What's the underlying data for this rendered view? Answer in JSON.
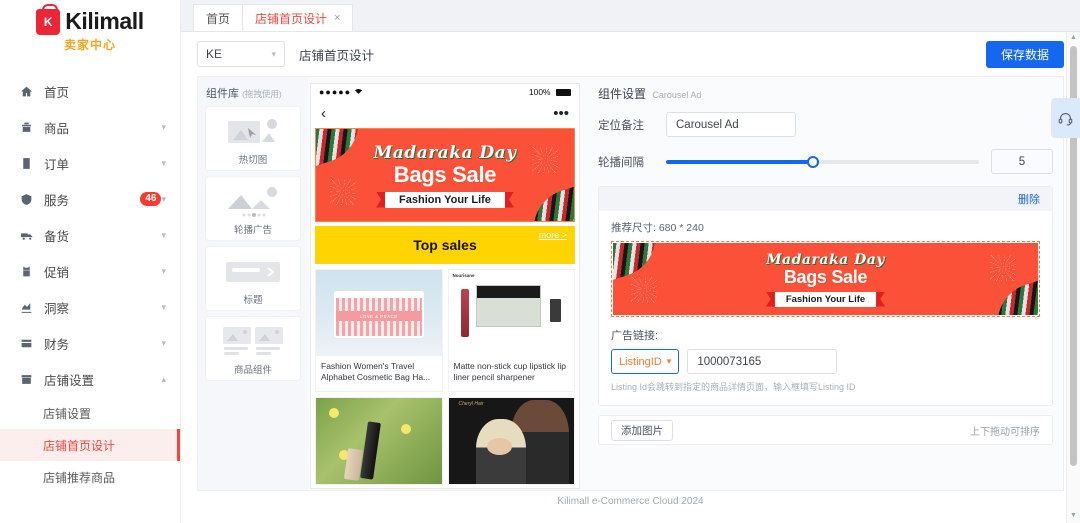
{
  "brand": {
    "name": "Kilimall",
    "sub": "卖家中心",
    "logo_letter": "K",
    "color": "#ee2536"
  },
  "sidebar": {
    "items": [
      {
        "icon": "home-icon",
        "label": "首页",
        "has_chevron": false
      },
      {
        "icon": "product-icon",
        "label": "商品",
        "has_chevron": true
      },
      {
        "icon": "order-icon",
        "label": "订单",
        "has_chevron": true
      },
      {
        "icon": "service-icon",
        "label": "服务",
        "badge": "46",
        "has_chevron": true
      },
      {
        "icon": "stock-icon",
        "label": "备货",
        "has_chevron": true
      },
      {
        "icon": "promotion-icon",
        "label": "促销",
        "has_chevron": true
      },
      {
        "icon": "insight-icon",
        "label": "洞察",
        "has_chevron": true
      },
      {
        "icon": "finance-icon",
        "label": "财务",
        "has_chevron": true
      },
      {
        "icon": "shop-settings-icon",
        "label": "店铺设置",
        "has_chevron": true,
        "expanded": true
      }
    ],
    "sub_items": [
      {
        "label": "店铺设置",
        "active": false
      },
      {
        "label": "店铺首页设计",
        "active": true
      },
      {
        "label": "店铺推荐商品",
        "active": false
      }
    ]
  },
  "tabs": [
    {
      "label": "首页",
      "active": false,
      "closable": false
    },
    {
      "label": "店铺首页设计",
      "active": true,
      "closable": true,
      "close_glyph": "×"
    }
  ],
  "toolbar": {
    "site_select": "KE",
    "page_title": "店铺首页设计",
    "save_label": "保存数据"
  },
  "component_library": {
    "title": "组件库",
    "title_hint": "(拖拽使用)",
    "items": [
      {
        "label": "热切图",
        "icon": "hotspot-image-icon"
      },
      {
        "label": "轮播广告",
        "icon": "carousel-ad-icon"
      },
      {
        "label": "标题",
        "icon": "title-block-icon"
      },
      {
        "label": "商品组件",
        "icon": "product-grid-icon"
      }
    ]
  },
  "phone_preview": {
    "status_bar": {
      "signal": "●●●●●",
      "wifi": "wifi-icon",
      "battery_text": "100%"
    },
    "nav": {
      "back": "‹",
      "menu": "•••"
    },
    "banner": {
      "script_text": "Madaraka Day",
      "main_text": "Bags Sale",
      "ribbon_text": "Fashion Your Life",
      "bg_color": "#fa5138"
    },
    "section_title": {
      "label": "Top sales",
      "more": "more >",
      "bg_color": "#ffd400"
    },
    "products": [
      {
        "title": "Fashion Women's Travel Alphabet Cosmetic Bag Ha...",
        "art": "cosmetic-bag",
        "badge_text": "LOVE & PEACE"
      },
      {
        "title": "Matte non-stick cup lipstick lip liner pencil sharpener",
        "art": "lipstick-set",
        "brand_text": "Nourisane"
      },
      {
        "title": "",
        "art": "mascara"
      },
      {
        "title": "",
        "art": "hair-model",
        "brand_text": "Cheryl Hair"
      }
    ]
  },
  "settings_panel": {
    "title": "组件设置",
    "title_sub": "Carousel Ad",
    "fields": {
      "position_note_label": "定位备注",
      "position_note_value": "Carousel Ad",
      "interval_label": "轮播间隔",
      "interval_value": "5",
      "slider_percent": 47
    },
    "item_card": {
      "delete_label": "删除",
      "recommended_size": "推荐尺寸: 680 * 240",
      "banner": {
        "script_text": "Madaraka Day",
        "main_text": "Bags Sale",
        "ribbon_text": "Fashion Your Life"
      },
      "ad_link_label": "广告链接:",
      "link_type": "ListingID",
      "link_value": "1000073165",
      "hint": "Listing Id会跳转到指定的商品详情页面，输入框填写Listing ID"
    },
    "add_bar": {
      "add_label": "添加图片",
      "drag_hint": "上下拖动可排序"
    }
  },
  "footer": {
    "text": "Kilimall e-Commerce Cloud 2024"
  },
  "right_rail": {
    "headset_icon": "headset-icon",
    "scroll_up": "▲",
    "scroll_down": "▼"
  }
}
